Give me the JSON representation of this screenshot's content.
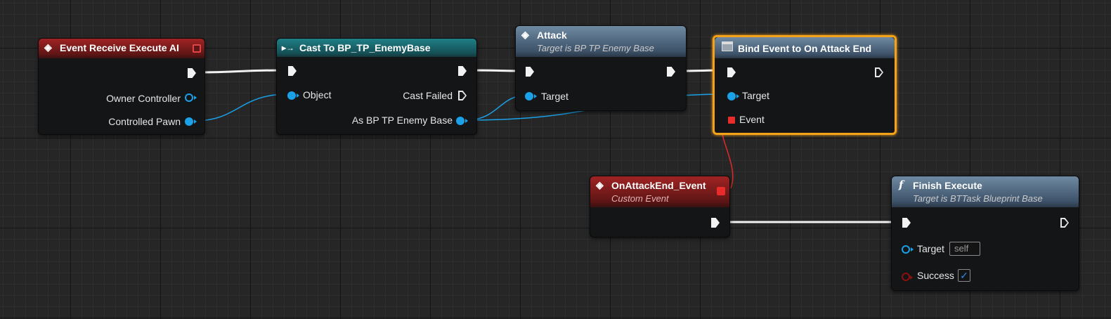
{
  "nodes": {
    "event_receive_execute_ai": {
      "title": "Event Receive Execute AI",
      "icon": "event-diamond-icon",
      "pins": {
        "owner_controller": "Owner Controller",
        "controlled_pawn": "Controlled Pawn"
      }
    },
    "cast_to": {
      "title": "Cast To BP_TP_EnemyBase",
      "icon": "cast-arrow-icon",
      "pins": {
        "object": "Object",
        "cast_failed": "Cast Failed",
        "as_enemy_base": "As BP TP Enemy Base"
      }
    },
    "attack": {
      "title": "Attack",
      "subtitle": "Target is BP TP Enemy Base",
      "icon": "function-diamond-icon",
      "pins": {
        "target": "Target"
      }
    },
    "bind_event": {
      "title": "Bind Event to On Attack End",
      "icon": "bind-event-icon",
      "pins": {
        "target": "Target",
        "event": "Event"
      }
    },
    "on_attack_end_event": {
      "title": "OnAttackEnd_Event",
      "subtitle": "Custom Event",
      "icon": "event-diamond-icon"
    },
    "finish_execute": {
      "title": "Finish Execute",
      "subtitle": "Target is BTTask Blueprint Base",
      "icon": "function-f-icon",
      "pins": {
        "target": "Target",
        "target_value": "self",
        "success": "Success",
        "success_checked": "✓"
      }
    }
  },
  "colors": {
    "exec": "#f2f2f2",
    "object_pin": "#1aa1e8",
    "delegate_pin": "#e82b2b",
    "bool_pin": "#8d1010",
    "selection": "#f5a21b",
    "event_header": "#a02323",
    "cast_header": "#1f7f87",
    "function_header": "#6e8aa2"
  }
}
